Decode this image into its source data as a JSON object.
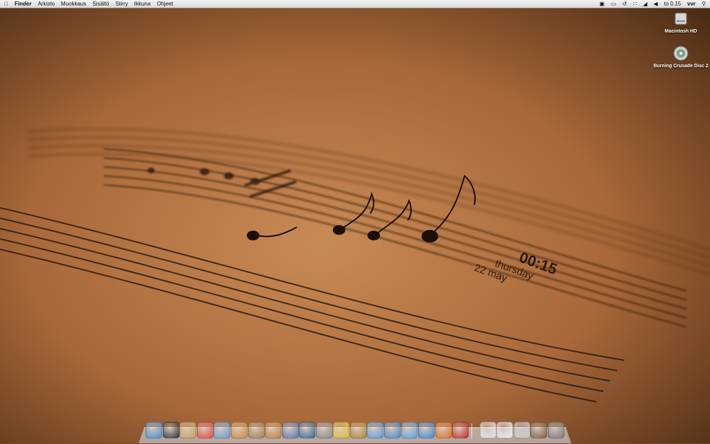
{
  "menubar": {
    "apple_icon": "apple-icon",
    "app_name": "Finder",
    "menus": [
      "Arkisto",
      "Muokkaus",
      "Sisältö",
      "Siirry",
      "Ikkuna",
      "Ohjeet"
    ],
    "status_icons": [
      "script-icon",
      "display-icon",
      "time-machine-icon",
      "bluetooth-icon",
      "wifi-icon",
      "volume-icon"
    ],
    "clock": "to 0.15",
    "user": "vvr",
    "spotlight_icon": "spotlight-icon"
  },
  "desktop_icons": [
    {
      "label": "Macintosh HD",
      "icon": "hard-drive-icon"
    },
    {
      "label": "Burning Crusade Disc 2",
      "icon": "disc-icon"
    }
  ],
  "clock_widget": {
    "time": "00:15",
    "day": "thursday",
    "date": "22 may"
  },
  "dock": {
    "apps": [
      {
        "icon": "finder-icon",
        "color": "#4a8fd8"
      },
      {
        "icon": "dashboard-icon",
        "color": "#333333"
      },
      {
        "icon": "mail-icon",
        "color": "#c9a45a"
      },
      {
        "icon": "ical-icon",
        "color": "#e84c3d"
      },
      {
        "icon": "preview-icon",
        "color": "#6aa0d8"
      },
      {
        "icon": "iphoto-icon",
        "color": "#d98b3a"
      },
      {
        "icon": "unknown-star-icon",
        "color": "#a08050"
      },
      {
        "icon": "garageband-icon",
        "color": "#c08040"
      },
      {
        "icon": "spaces-icon",
        "color": "#5a7ab0"
      },
      {
        "icon": "time-machine-icon",
        "color": "#2f6a9a"
      },
      {
        "icon": "system-preferences-icon",
        "color": "#8a8a8a"
      },
      {
        "icon": "sun-icon",
        "color": "#e0c030"
      },
      {
        "icon": "warcraft-icon",
        "color": "#b08830"
      },
      {
        "icon": "itunes-icon",
        "color": "#5aa0e0"
      },
      {
        "icon": "photos-icon",
        "color": "#4a88c8"
      },
      {
        "icon": "ichat-icon",
        "color": "#5aa8e8"
      },
      {
        "icon": "safari-icon",
        "color": "#3a8ad8"
      },
      {
        "icon": "firefox-icon",
        "color": "#e07020"
      },
      {
        "icon": "transmission-icon",
        "color": "#c03020"
      }
    ],
    "docs": [
      {
        "icon": "document-icon",
        "color": "#e8e8e8"
      },
      {
        "icon": "document-icon",
        "color": "#f0f0f0"
      },
      {
        "icon": "downloads-stack-icon",
        "color": "#c8c8c8"
      },
      {
        "icon": "pictures-stack-icon",
        "color": "#806040"
      },
      {
        "icon": "trash-icon",
        "color": "#7a7a7a"
      }
    ]
  }
}
